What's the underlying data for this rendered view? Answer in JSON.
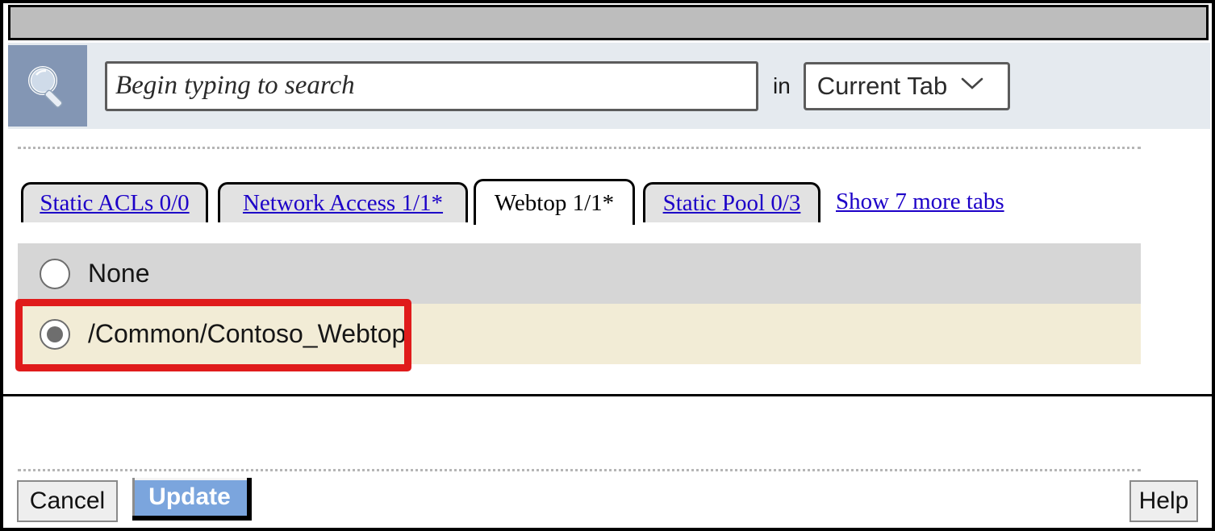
{
  "colors": {
    "accent_blue": "#7ba5dd",
    "search_icon_bg": "#8396b4",
    "search_bar_bg": "#e5eaef",
    "topbar_gray": "#bdbdbd",
    "row_gray": "#d6d6d6",
    "row_cream": "#f2ecd6",
    "link_blue": "#1c00c8",
    "highlight_red": "#e01b1b"
  },
  "search": {
    "icon": "magnifier-icon",
    "placeholder": "Begin typing to search",
    "value": "",
    "in_label": "in",
    "scope_value": "Current Tab",
    "scope_chevron": "chevron-down-icon"
  },
  "tabs": {
    "items": [
      {
        "label": "Static ACLs 0/0",
        "active": false
      },
      {
        "label": "Network Access 1/1*",
        "active": false
      },
      {
        "label": "Webtop 1/1*",
        "active": true
      },
      {
        "label": "Static Pool 0/3",
        "active": false
      }
    ],
    "more_link": "Show 7 more tabs"
  },
  "options": [
    {
      "label": "None",
      "checked": false
    },
    {
      "label": "/Common/Contoso_Webtop",
      "checked": true
    }
  ],
  "footer": {
    "cancel_label": "Cancel",
    "update_label": "Update",
    "help_label": "Help"
  }
}
